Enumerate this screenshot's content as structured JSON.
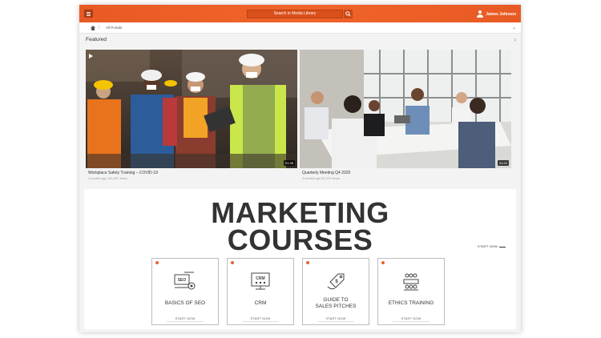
{
  "header": {
    "search_label": "Search in Media Library",
    "user_name": "James Johnson",
    "menu_icon": "hamburger-menu-icon",
    "search_icon": "search-icon",
    "user_icon": "user-avatar-icon",
    "accent_color": "#f0642a"
  },
  "breadcrumb": {
    "home_icon": "home-icon",
    "current": "All Portals"
  },
  "featured": {
    "title": "Featured",
    "items": [
      {
        "title": "Workplace Safety Training –  COVID-19",
        "meta": "2 months ago  151,457 Views",
        "duration": "01:38"
      },
      {
        "title": "Quarterly Meeting Q4 2020",
        "meta": "3 months ago  50,103 Views",
        "duration": "02:20"
      }
    ]
  },
  "marketing": {
    "heading_line1": "MARKETING",
    "heading_line2": "COURSES",
    "start_now": "START NOW",
    "courses": [
      {
        "line1": "BASICS OF SEO",
        "line2": "",
        "cta": "START NOW",
        "icon": "seo-gear-icon"
      },
      {
        "line1": "CRM",
        "line2": "",
        "cta": "START NOW",
        "icon": "crm-monitor-icon"
      },
      {
        "line1": "GUIDE TO",
        "line2": "SALES PITCHES",
        "cta": "START NOW",
        "icon": "price-tag-icon"
      },
      {
        "line1": "ETHICS TRAINING",
        "line2": "",
        "cta": "START NOW",
        "icon": "meeting-table-icon"
      }
    ]
  }
}
